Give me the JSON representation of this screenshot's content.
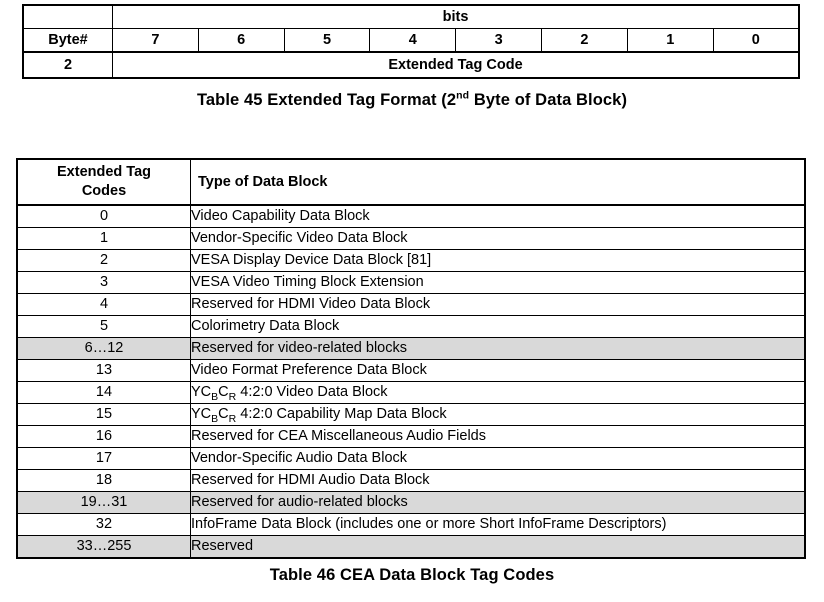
{
  "table45": {
    "name": "Extended Tag Format bit table",
    "bits_header": "bits",
    "byte_header": "Byte#",
    "bit_labels": [
      "7",
      "6",
      "5",
      "4",
      "3",
      "2",
      "1",
      "0"
    ],
    "row": {
      "byte": "2",
      "field": "Extended Tag Code"
    },
    "caption_prefix": "Table 45 Extended Tag Format (2",
    "caption_sup": "nd",
    "caption_suffix": " Byte of Data Block)"
  },
  "table46": {
    "name": "CEA Data Block Tag Codes table",
    "headers": {
      "code": "Extended Tag Codes",
      "code_line1": "Extended Tag",
      "code_line2": "Codes",
      "type": "Type of Data Block"
    },
    "rows": [
      {
        "code": "0",
        "type": "Video Capability Data Block",
        "shaded": false
      },
      {
        "code": "1",
        "type": "Vendor-Specific Video Data Block",
        "shaded": false
      },
      {
        "code": "2",
        "type": "VESA Display Device Data Block [81]",
        "shaded": false
      },
      {
        "code": "3",
        "type": "VESA Video Timing Block Extension",
        "shaded": false
      },
      {
        "code": "4",
        "type": "Reserved for HDMI Video Data Block",
        "shaded": false
      },
      {
        "code": "5",
        "type": "Colorimetry Data Block",
        "shaded": false
      },
      {
        "code": "6…12",
        "type": "Reserved for video-related blocks",
        "shaded": true
      },
      {
        "code": "13",
        "type": "Video Format Preference Data Block",
        "shaded": false
      },
      {
        "code": "14",
        "type": "YCBCR 4:2:0 Video Data Block",
        "type_html": "YC<sub>B</sub>C<sub>R</sub> 4:2:0 Video Data Block",
        "shaded": false
      },
      {
        "code": "15",
        "type": "YCBCR 4:2:0 Capability Map Data Block",
        "type_html": "YC<sub>B</sub>C<sub>R</sub> 4:2:0 Capability Map Data Block",
        "shaded": false
      },
      {
        "code": "16",
        "type": "Reserved for CEA Miscellaneous Audio Fields",
        "shaded": false
      },
      {
        "code": "17",
        "type": "Vendor-Specific Audio Data Block",
        "shaded": false
      },
      {
        "code": "18",
        "type": "Reserved for HDMI Audio Data Block",
        "shaded": false
      },
      {
        "code": "19…31",
        "type": "Reserved for audio-related blocks",
        "shaded": true
      },
      {
        "code": "32",
        "type": "InfoFrame Data Block (includes one or more Short InfoFrame Descriptors)",
        "shaded": false
      },
      {
        "code": "33…255",
        "type": "Reserved",
        "shaded": true
      }
    ],
    "caption": "Table 46 CEA Data Block Tag Codes"
  },
  "colors": {
    "page_background": "#ffffff",
    "text": "#000000",
    "border": "#000000",
    "shaded_row": "#d9d9d9"
  }
}
